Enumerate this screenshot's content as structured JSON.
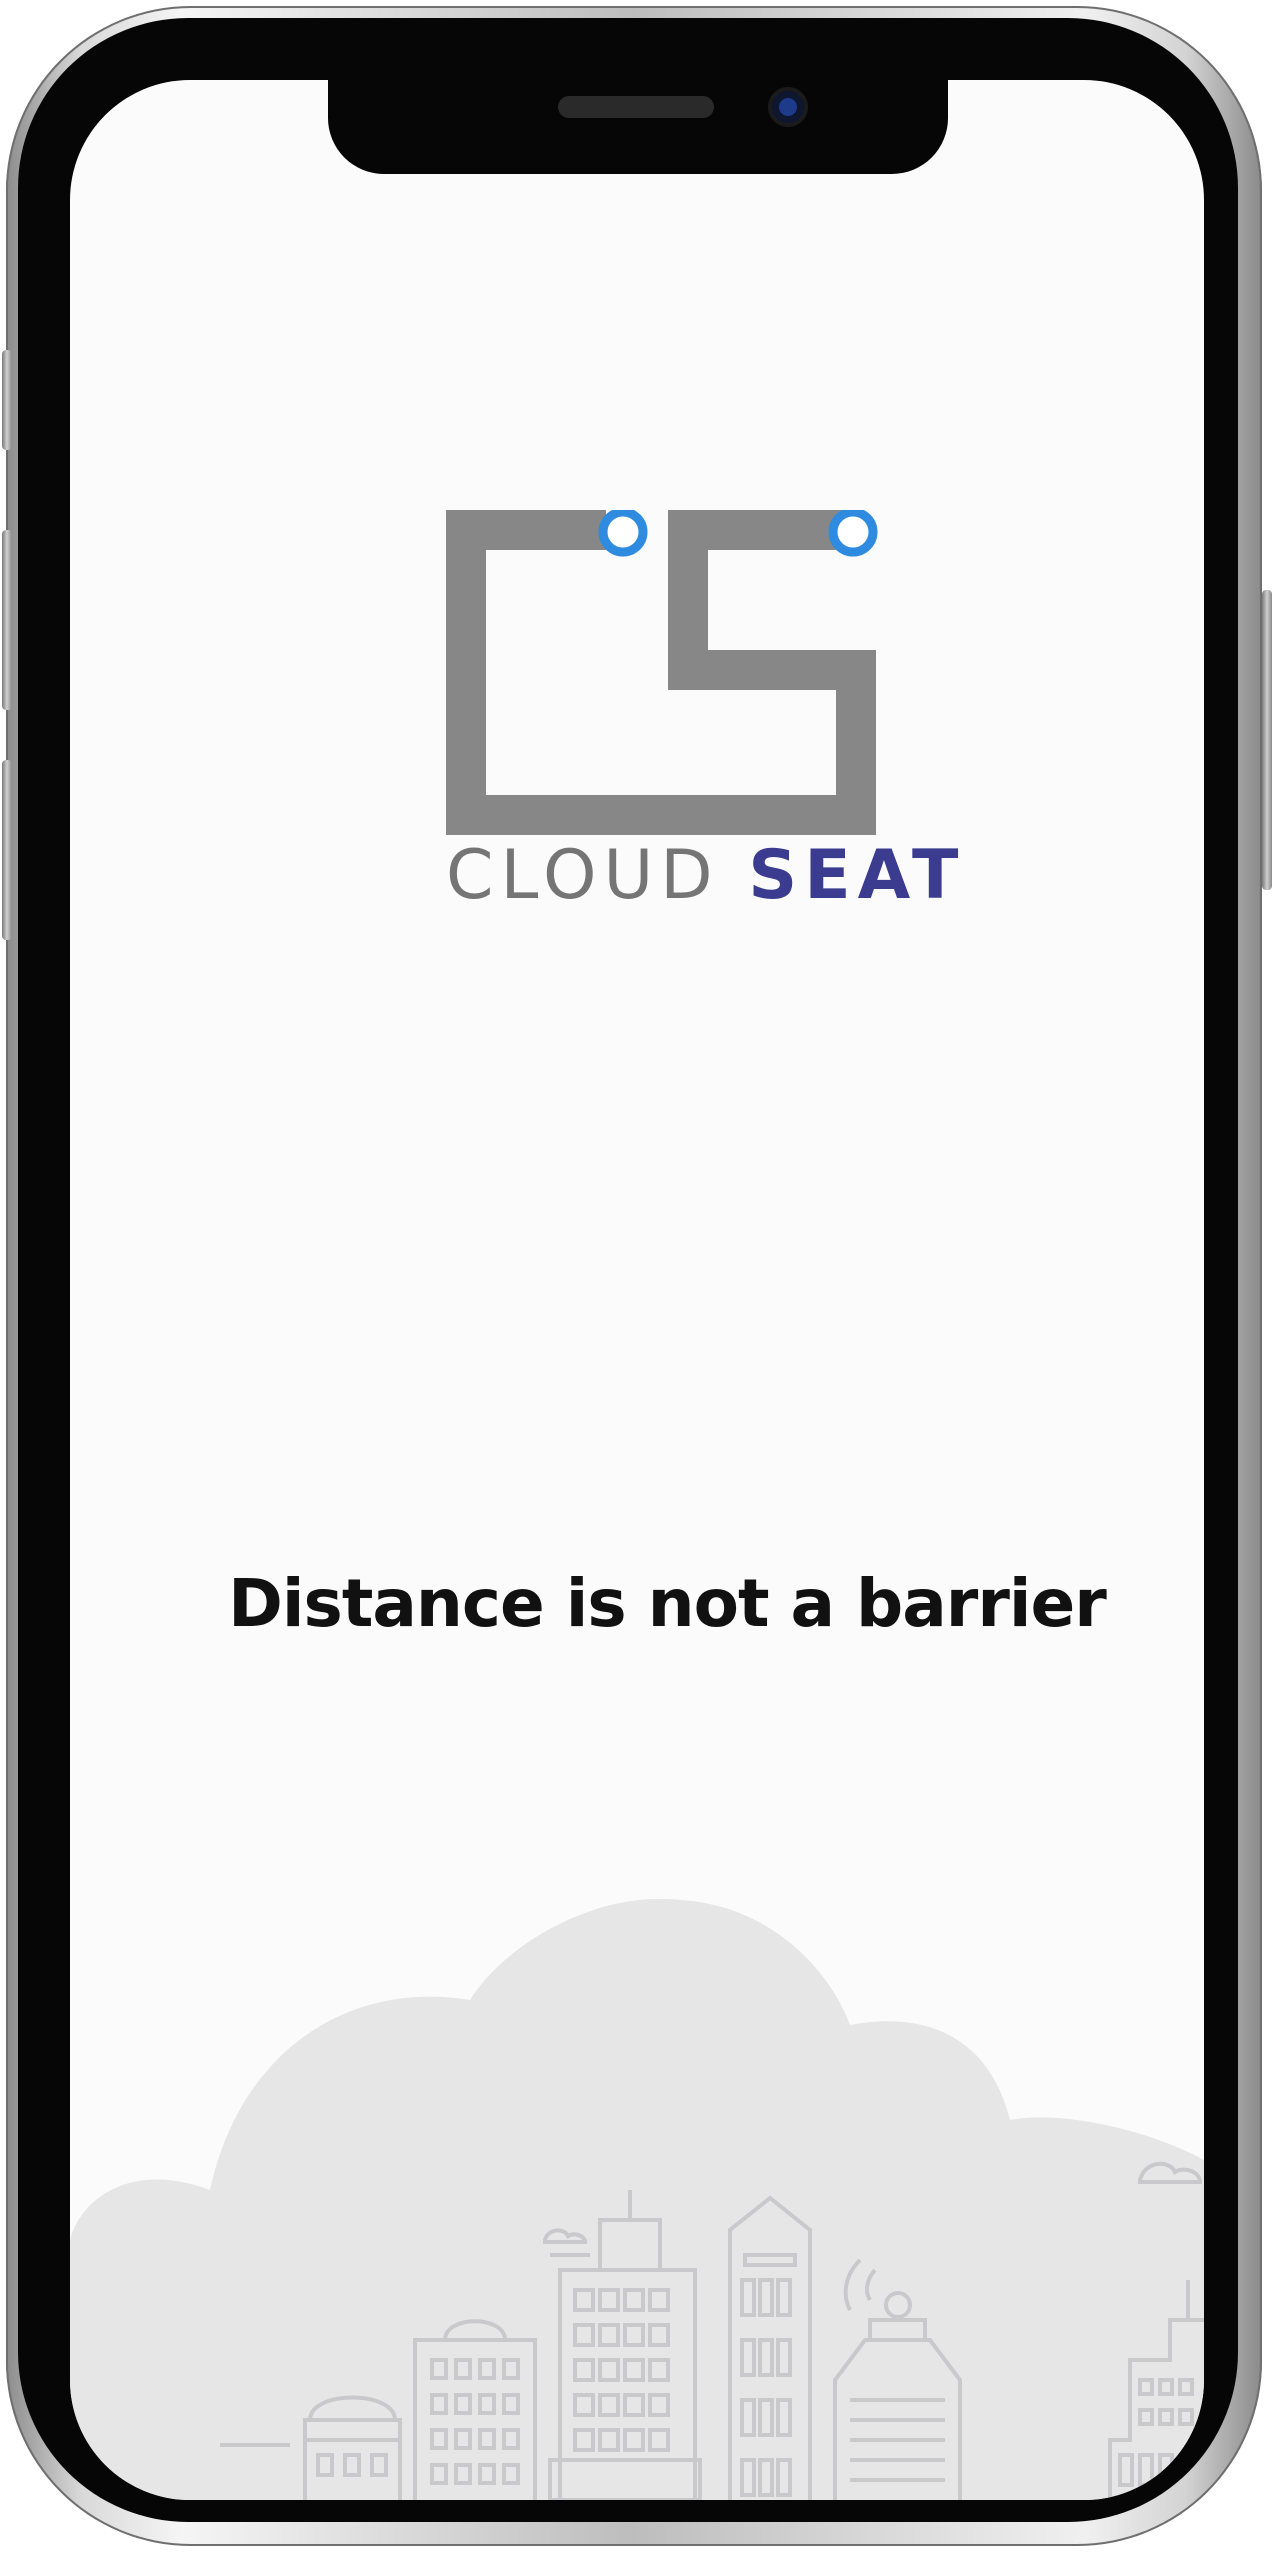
{
  "brand": {
    "word1": "CLOUD",
    "word2": "SEAT",
    "logo_primary_color": "#878787",
    "logo_accent_color": "#2f8be0",
    "word2_color": "#3b3c8f"
  },
  "tagline": "Distance is not a barrier",
  "illustration": {
    "name": "city-skyline-cloud",
    "cloud_color": "#e6e6e7",
    "line_color": "#c9c9cb"
  }
}
